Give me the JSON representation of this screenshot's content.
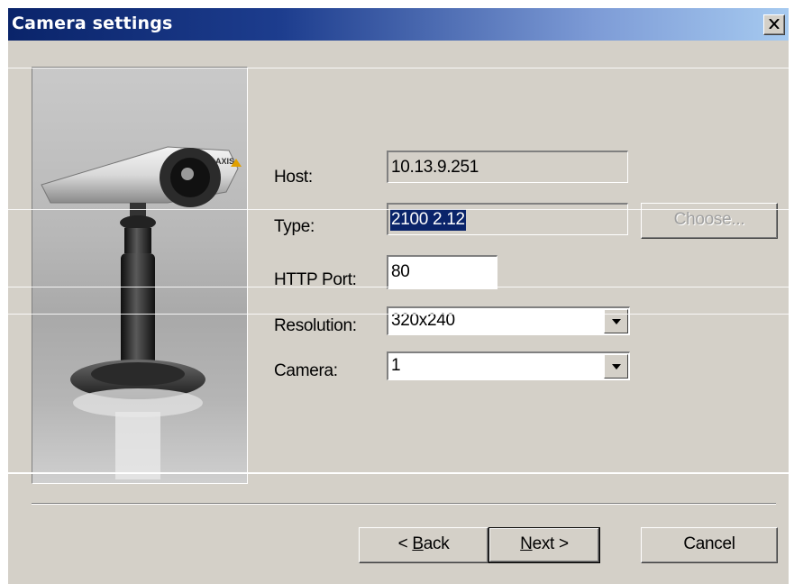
{
  "window": {
    "title": "Camera settings",
    "close_glyph": "close-icon"
  },
  "form": {
    "host": {
      "label": "Host:",
      "value": "10.13.9.251"
    },
    "type": {
      "label": "Type:",
      "value": "2100 2.12",
      "choose_label": "Choose..."
    },
    "http_port": {
      "label": "HTTP Port:",
      "value": "80"
    },
    "resolution": {
      "label": "Resolution:",
      "value": "320x240"
    },
    "camera": {
      "label": "Camera:",
      "value": "1"
    }
  },
  "buttons": {
    "back": {
      "prefix": "< ",
      "mnemonic": "B",
      "rest": "ack"
    },
    "next": {
      "mnemonic": "N",
      "rest": "ext >"
    },
    "cancel": "Cancel"
  },
  "camera_image": {
    "brand_text": "AXIS"
  },
  "colors": {
    "titlebar_start": "#0a246a",
    "titlebar_end": "#a6caf0",
    "dialog_face": "#d4d0c8",
    "selection": "#0a246a"
  }
}
